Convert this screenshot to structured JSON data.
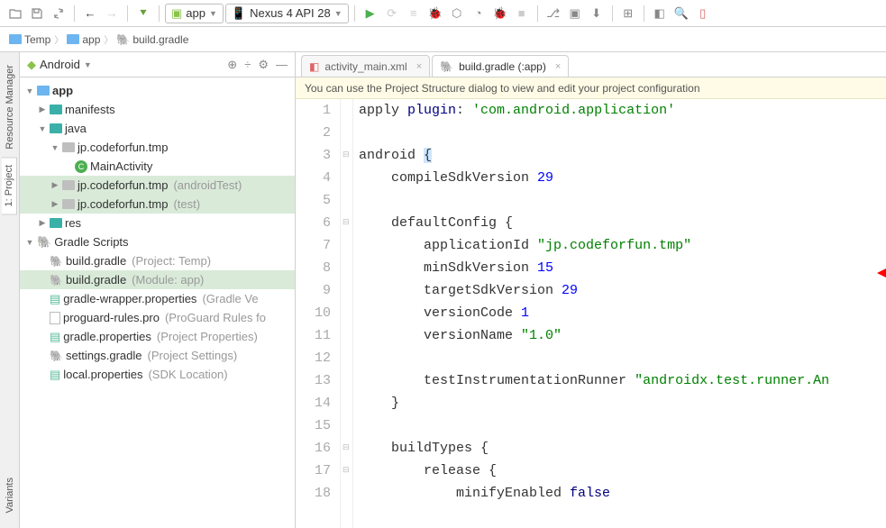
{
  "toolbar": {
    "app_combo": "app",
    "device_combo": "Nexus 4 API 28"
  },
  "breadcrumb": {
    "items": [
      "Temp",
      "app",
      "build.gradle"
    ]
  },
  "left_rail": {
    "tabs": [
      "Resource Manager",
      "1: Project",
      "Variants"
    ]
  },
  "sidebar": {
    "title": "Android",
    "tree": [
      {
        "depth": 0,
        "tw": "▼",
        "icon": "module",
        "label": "app",
        "qual": "",
        "selected": false,
        "bold": true
      },
      {
        "depth": 1,
        "tw": "▶",
        "icon": "folder-teal",
        "label": "manifests",
        "qual": "",
        "selected": false
      },
      {
        "depth": 1,
        "tw": "▼",
        "icon": "folder-teal",
        "label": "java",
        "qual": "",
        "selected": false
      },
      {
        "depth": 2,
        "tw": "▼",
        "icon": "folder-grey",
        "label": "jp.codeforfun.tmp",
        "qual": "",
        "selected": false
      },
      {
        "depth": 3,
        "tw": "",
        "icon": "class",
        "label": "MainActivity",
        "qual": "",
        "selected": false
      },
      {
        "depth": 2,
        "tw": "▶",
        "icon": "folder-grey",
        "label": "jp.codeforfun.tmp",
        "qual": "(androidTest)",
        "selected": true
      },
      {
        "depth": 2,
        "tw": "▶",
        "icon": "folder-grey",
        "label": "jp.codeforfun.tmp",
        "qual": "(test)",
        "selected": true
      },
      {
        "depth": 1,
        "tw": "▶",
        "icon": "folder-teal",
        "label": "res",
        "qual": "",
        "selected": false
      },
      {
        "depth": 0,
        "tw": "▼",
        "icon": "gradle-grp",
        "label": "Gradle Scripts",
        "qual": "",
        "selected": false
      },
      {
        "depth": 1,
        "tw": "",
        "icon": "gradle",
        "label": "build.gradle",
        "qual": "(Project: Temp)",
        "selected": false
      },
      {
        "depth": 1,
        "tw": "",
        "icon": "gradle",
        "label": "build.gradle",
        "qual": "(Module: app)",
        "selected": true
      },
      {
        "depth": 1,
        "tw": "",
        "icon": "prop",
        "label": "gradle-wrapper.properties",
        "qual": "(Gradle Ve",
        "selected": false
      },
      {
        "depth": 1,
        "tw": "",
        "icon": "file",
        "label": "proguard-rules.pro",
        "qual": "(ProGuard Rules fo",
        "selected": false
      },
      {
        "depth": 1,
        "tw": "",
        "icon": "prop",
        "label": "gradle.properties",
        "qual": "(Project Properties)",
        "selected": false
      },
      {
        "depth": 1,
        "tw": "",
        "icon": "gradle",
        "label": "settings.gradle",
        "qual": "(Project Settings)",
        "selected": false
      },
      {
        "depth": 1,
        "tw": "",
        "icon": "prop",
        "label": "local.properties",
        "qual": "(SDK Location)",
        "selected": false
      }
    ]
  },
  "editor": {
    "tabs": [
      {
        "label": "activity_main.xml",
        "active": false
      },
      {
        "label": "build.gradle (:app)",
        "active": true
      }
    ],
    "hint": "You can use the Project Structure dialog to view and edit your project configuration",
    "lines": {
      "1": {
        "n": "1",
        "html": "<span class='id'>apply </span><span class='kw'>plugin</span>: <span class='str'>'com.android.application'</span>"
      },
      "2": {
        "n": "2",
        "html": ""
      },
      "3": {
        "n": "3",
        "html": "<span class='id'>android </span><span class='hl'>{</span>"
      },
      "4": {
        "n": "4",
        "html": "    compileSdkVersion <span class='num'>29</span>"
      },
      "5": {
        "n": "5",
        "html": ""
      },
      "6": {
        "n": "6",
        "html": "    defaultConfig {"
      },
      "7": {
        "n": "7",
        "html": "        applicationId <span class='str'>\"jp.codeforfun.tmp\"</span>"
      },
      "8": {
        "n": "8",
        "html": "        minSdkVersion <span class='num'>15</span>"
      },
      "9": {
        "n": "9",
        "html": "        targetSdkVersion <span class='num'>29</span>"
      },
      "10": {
        "n": "10",
        "html": "        versionCode <span class='num'>1</span>"
      },
      "11": {
        "n": "11",
        "html": "        versionName <span class='str'>\"1.0\"</span>"
      },
      "12": {
        "n": "12",
        "html": ""
      },
      "13": {
        "n": "13",
        "html": "        testInstrumentationRunner <span class='str'>\"androidx.test.runner.An</span>"
      },
      "14": {
        "n": "14",
        "html": "    }"
      },
      "15": {
        "n": "15",
        "html": ""
      },
      "16": {
        "n": "16",
        "html": "    buildTypes {"
      },
      "17": {
        "n": "17",
        "html": "        release {"
      },
      "18": {
        "n": "18",
        "html": "            minifyEnabled <span class='kw'>false</span>"
      }
    }
  }
}
